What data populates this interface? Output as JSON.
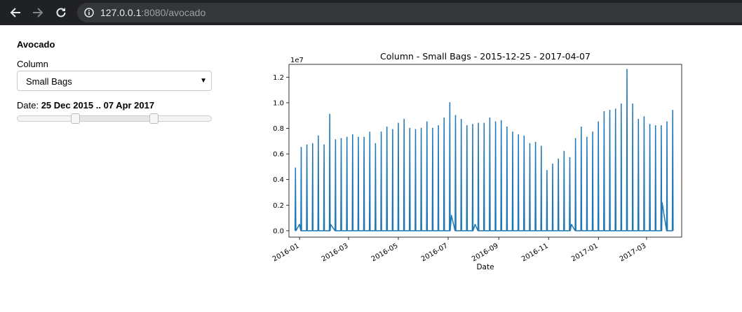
{
  "browser": {
    "url_host": "127.0.0.1",
    "url_rest": ":8080/avocado"
  },
  "app": {
    "title": "Avocado",
    "column_label": "Column",
    "column_value": "Small Bags",
    "date_prefix": "Date: ",
    "date_range_text": "25 Dec 2015 .. 07 Apr 2017",
    "slider": {
      "low_fraction": 0.3,
      "high_fraction": 0.7
    }
  },
  "chart_data": {
    "type": "line",
    "title": "Column - Small Bags - 2015-12-25 - 2017-04-07",
    "xlabel": "Date",
    "ylabel": "",
    "offset_text": "1e7",
    "ylim": [
      -0.05,
      1.3
    ],
    "xlim": [
      "2015-12-19",
      "2017-04-13"
    ],
    "color": "#1f77b4",
    "y_ticks": [
      "0.0",
      "0.2",
      "0.4",
      "0.6",
      "0.8",
      "1.0",
      "1.2"
    ],
    "x_ticks": [
      "2016-01",
      "2016-03",
      "2016-05",
      "2016-07",
      "2016-09",
      "2016-11",
      "2017-01",
      "2017-03"
    ],
    "peaks": [
      {
        "x": "2015-12-27",
        "y": 0.49
      },
      {
        "x": "2016-01-03",
        "y": 0.65
      },
      {
        "x": "2016-01-10",
        "y": 0.67
      },
      {
        "x": "2016-01-17",
        "y": 0.68
      },
      {
        "x": "2016-01-24",
        "y": 0.74
      },
      {
        "x": "2016-01-31",
        "y": 0.67
      },
      {
        "x": "2016-02-07",
        "y": 0.91
      },
      {
        "x": "2016-02-14",
        "y": 0.71
      },
      {
        "x": "2016-02-21",
        "y": 0.72
      },
      {
        "x": "2016-02-28",
        "y": 0.73
      },
      {
        "x": "2016-03-06",
        "y": 0.75
      },
      {
        "x": "2016-03-13",
        "y": 0.73
      },
      {
        "x": "2016-03-20",
        "y": 0.73
      },
      {
        "x": "2016-03-27",
        "y": 0.77
      },
      {
        "x": "2016-04-03",
        "y": 0.68
      },
      {
        "x": "2016-04-10",
        "y": 0.77
      },
      {
        "x": "2016-04-17",
        "y": 0.81
      },
      {
        "x": "2016-04-24",
        "y": 0.79
      },
      {
        "x": "2016-05-01",
        "y": 0.84
      },
      {
        "x": "2016-05-08",
        "y": 0.87
      },
      {
        "x": "2016-05-15",
        "y": 0.8
      },
      {
        "x": "2016-05-22",
        "y": 0.79
      },
      {
        "x": "2016-05-29",
        "y": 0.8
      },
      {
        "x": "2016-06-05",
        "y": 0.85
      },
      {
        "x": "2016-06-12",
        "y": 0.8
      },
      {
        "x": "2016-06-19",
        "y": 0.82
      },
      {
        "x": "2016-06-26",
        "y": 0.88
      },
      {
        "x": "2016-07-03",
        "y": 1.0
      },
      {
        "x": "2016-07-10",
        "y": 0.9
      },
      {
        "x": "2016-07-17",
        "y": 0.87
      },
      {
        "x": "2016-07-24",
        "y": 0.82
      },
      {
        "x": "2016-07-31",
        "y": 0.83
      },
      {
        "x": "2016-08-07",
        "y": 0.84
      },
      {
        "x": "2016-08-14",
        "y": 0.84
      },
      {
        "x": "2016-08-21",
        "y": 0.88
      },
      {
        "x": "2016-08-28",
        "y": 0.85
      },
      {
        "x": "2016-09-04",
        "y": 0.86
      },
      {
        "x": "2016-09-11",
        "y": 0.81
      },
      {
        "x": "2016-09-18",
        "y": 0.77
      },
      {
        "x": "2016-09-25",
        "y": 0.75
      },
      {
        "x": "2016-10-02",
        "y": 0.74
      },
      {
        "x": "2016-10-09",
        "y": 0.68
      },
      {
        "x": "2016-10-16",
        "y": 0.69
      },
      {
        "x": "2016-10-23",
        "y": 0.66
      },
      {
        "x": "2016-10-30",
        "y": 0.47
      },
      {
        "x": "2016-11-06",
        "y": 0.52
      },
      {
        "x": "2016-11-13",
        "y": 0.56
      },
      {
        "x": "2016-11-20",
        "y": 0.62
      },
      {
        "x": "2016-11-27",
        "y": 0.57
      },
      {
        "x": "2016-12-04",
        "y": 0.72
      },
      {
        "x": "2016-12-11",
        "y": 0.81
      },
      {
        "x": "2016-12-18",
        "y": 0.73
      },
      {
        "x": "2016-12-25",
        "y": 0.77
      },
      {
        "x": "2017-01-01",
        "y": 0.85
      },
      {
        "x": "2017-01-08",
        "y": 0.93
      },
      {
        "x": "2017-01-15",
        "y": 0.94
      },
      {
        "x": "2017-01-22",
        "y": 0.95
      },
      {
        "x": "2017-01-29",
        "y": 0.99
      },
      {
        "x": "2017-02-05",
        "y": 1.26
      },
      {
        "x": "2017-02-12",
        "y": 0.99
      },
      {
        "x": "2017-02-19",
        "y": 0.87
      },
      {
        "x": "2017-02-26",
        "y": 0.89
      },
      {
        "x": "2017-03-05",
        "y": 0.83
      },
      {
        "x": "2017-03-12",
        "y": 0.82
      },
      {
        "x": "2017-03-19",
        "y": 0.82
      },
      {
        "x": "2017-03-26",
        "y": 0.85
      },
      {
        "x": "2017-04-02",
        "y": 0.94
      }
    ],
    "baseline_bumps": [
      {
        "x": "2016-01-01",
        "y": 0.05
      },
      {
        "x": "2016-02-08",
        "y": 0.05
      },
      {
        "x": "2016-04-10",
        "y": 0.1
      },
      {
        "x": "2016-07-05",
        "y": 0.12
      },
      {
        "x": "2016-08-03",
        "y": 0.05
      },
      {
        "x": "2016-09-18",
        "y": 0.1
      },
      {
        "x": "2016-11-29",
        "y": 0.05
      },
      {
        "x": "2017-03-20",
        "y": 0.22
      }
    ]
  }
}
